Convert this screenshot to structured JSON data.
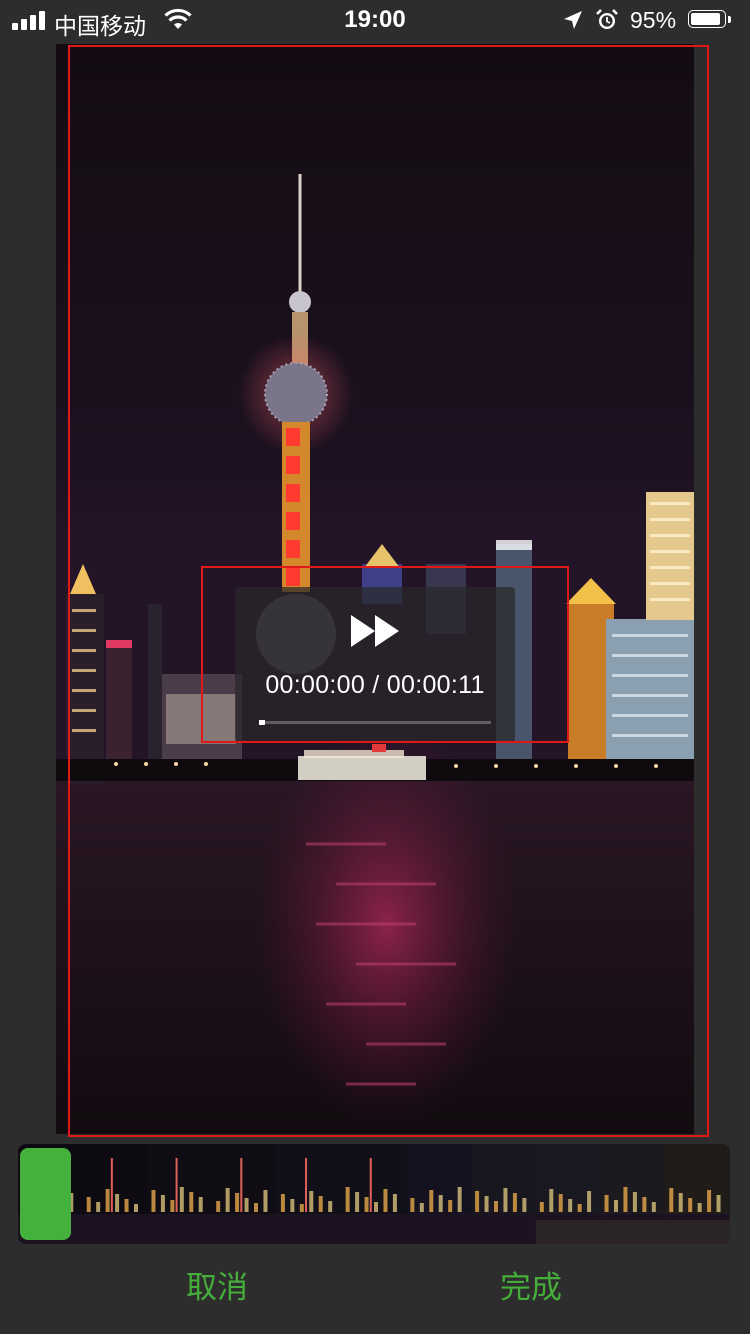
{
  "status_bar": {
    "carrier": "中国移动",
    "time": "19:00",
    "battery_percent": "95%",
    "battery_level": 0.95,
    "icons": [
      "signal-icon",
      "wifi-icon",
      "location-icon",
      "alarm-icon",
      "battery-icon"
    ]
  },
  "player": {
    "time_display": "00:00:00 / 00:00:11",
    "progress": 0.0,
    "play_icon": "fast-forward-icon"
  },
  "timeline": {
    "thumbnail_count": 11
  },
  "buttons": {
    "cancel": "取消",
    "done": "完成"
  },
  "colors": {
    "accent": "#45ad3a",
    "crop_border": "#e01818",
    "background": "#2d2d2d"
  }
}
